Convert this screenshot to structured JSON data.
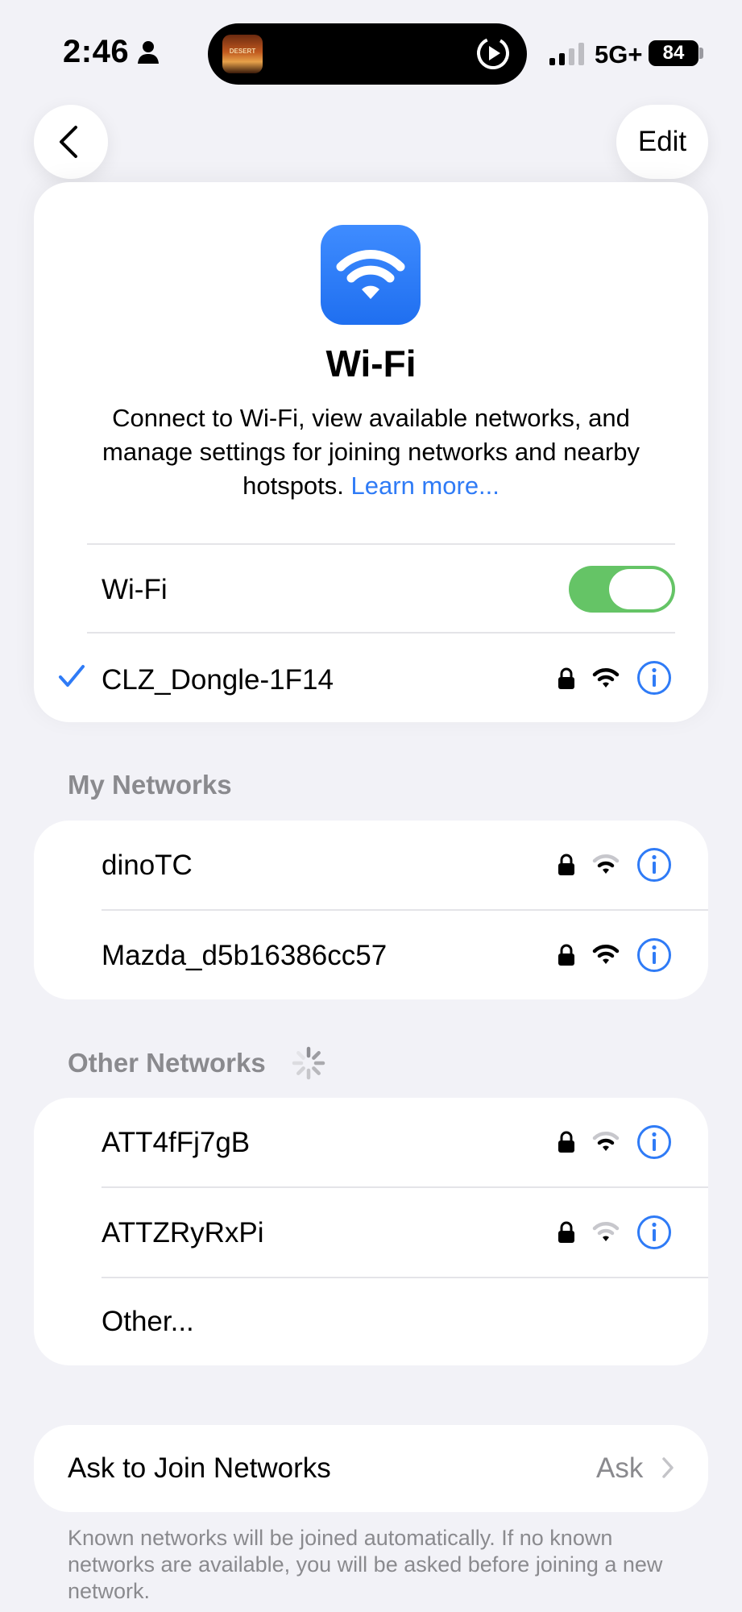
{
  "status_bar": {
    "time": "2:46",
    "network_type": "5G+",
    "battery": "84",
    "now_playing_art_text": "DESERT"
  },
  "nav": {
    "edit_label": "Edit"
  },
  "hero": {
    "title": "Wi-Fi",
    "description": "Connect to Wi-Fi, view available networks, and manage settings for joining networks and nearby hotspots.",
    "link": "Learn more..."
  },
  "wifi_toggle": {
    "label": "Wi-Fi",
    "on": true
  },
  "connected_network": {
    "name": "CLZ_Dongle-1F14"
  },
  "my_networks": {
    "header": "My Networks",
    "items": [
      {
        "name": "dinoTC",
        "signal": 2
      },
      {
        "name": "Mazda_d5b16386cc57",
        "signal": 3
      }
    ]
  },
  "other_networks": {
    "header": "Other Networks",
    "items": [
      {
        "name": "ATT4fFj7gB",
        "signal": 2
      },
      {
        "name": "ATTZRyRxPi",
        "signal": 1
      }
    ],
    "other_label": "Other..."
  },
  "ask_to_join": {
    "label": "Ask to Join Networks",
    "value": "Ask",
    "footer": "Known networks will be joined automatically. If no known networks are available, you will be asked before joining a new network."
  },
  "colors": {
    "accent": "#2f7bf6",
    "toggle_on": "#65c466",
    "background": "#f2f2f7",
    "secondary_text": "#8a8a8e"
  }
}
